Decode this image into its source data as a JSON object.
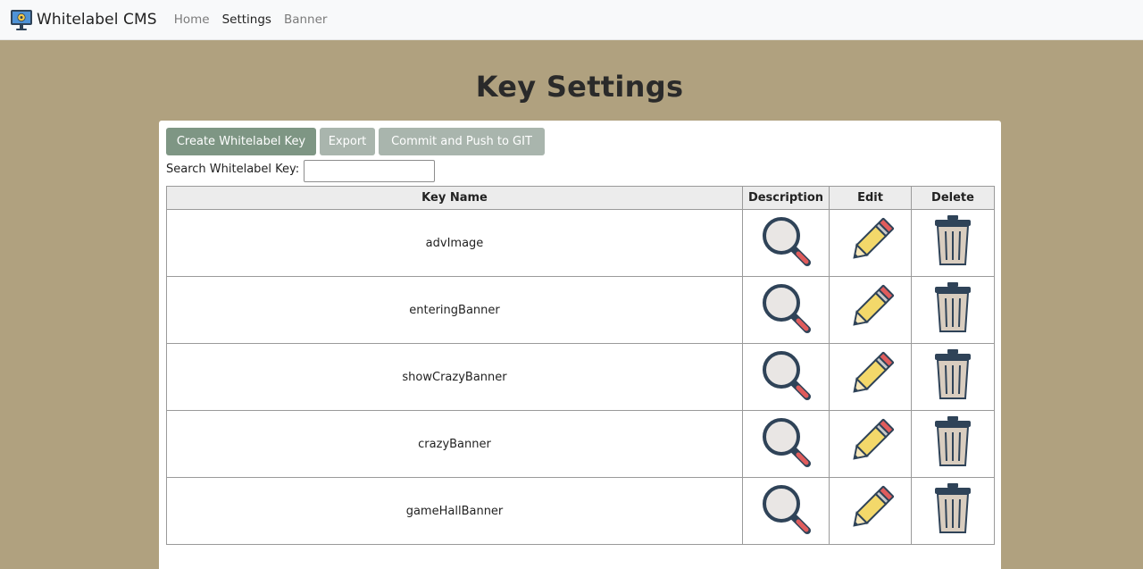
{
  "app": {
    "brand": "Whitelabel CMS"
  },
  "nav": {
    "items": [
      "Home",
      "Settings",
      "Banner"
    ],
    "active": "Settings"
  },
  "page": {
    "title": "Key Settings"
  },
  "toolbar": {
    "create_label": "Create Whitelabel Key",
    "export_label": "Export",
    "commit_label": "Commit and Push to GIT"
  },
  "search": {
    "label": "Search Whitelabel Key:",
    "value": "",
    "placeholder": ""
  },
  "table": {
    "headers": [
      "Key Name",
      "Description",
      "Edit",
      "Delete"
    ],
    "rows": [
      {
        "key_name": "advImage"
      },
      {
        "key_name": "enteringBanner"
      },
      {
        "key_name": "showCrazyBanner"
      },
      {
        "key_name": "crazyBanner"
      },
      {
        "key_name": "gameHallBanner"
      }
    ]
  },
  "icons": {
    "description": "magnifier-icon",
    "edit": "pencil-icon",
    "delete": "trash-icon",
    "brand": "monitor-gear-icon"
  },
  "colors": {
    "background": "#b0a17f",
    "navbar": "#f8f9fa",
    "primary_button": "#7e9684",
    "secondary_button": "#a9b5ad",
    "icon_dark": "#2f4358",
    "pencil_yellow": "#f3d86a",
    "pencil_red": "#e05c5c",
    "trash_fill": "#d9cdbf"
  }
}
